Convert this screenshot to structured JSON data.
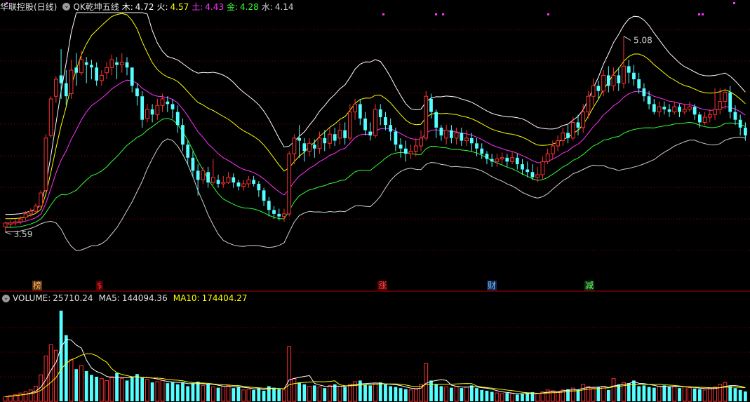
{
  "header": {
    "stock_name": "华联控股(日线)",
    "indicator_name": "QK乾坤五线",
    "values": [
      {
        "label": "木:",
        "value": "4.72",
        "color": "#ffffff"
      },
      {
        "label": "火:",
        "value": "4.57",
        "color": "#ffff00"
      },
      {
        "label": "土:",
        "value": "4.43",
        "color": "#ff33ff"
      },
      {
        "label": "金:",
        "value": "4.28",
        "color": "#33ff33"
      },
      {
        "label": "水:",
        "value": "4.14",
        "color": "#d0d0d0"
      }
    ]
  },
  "volume_header": {
    "name": "VOLUME:",
    "value": "25710.24",
    "ma5_label": "MA5:",
    "ma5_value": "144094.36",
    "ma10_label": "MA10:",
    "ma10_value": "174404.27"
  },
  "annotations": {
    "high_label": "5.08",
    "low_label": "3.59"
  },
  "signals": [
    {
      "text": "榜",
      "color": "#ffb366",
      "bg": "#5a3510"
    },
    {
      "text": "$",
      "color": "#ff3030",
      "bg": "#500000"
    },
    {
      "text": "涨",
      "color": "#ff5050",
      "bg": "#500000"
    },
    {
      "text": "财",
      "color": "#80c0ff",
      "bg": "#102850"
    },
    {
      "text": "减",
      "color": "#66ff66",
      "bg": "#103510"
    }
  ],
  "colors": {
    "up": "#ff3232",
    "down": "#54ffff",
    "grid": "#8b0000",
    "upper_band": "#ffffff",
    "mid_upper": "#ffff00",
    "middle": "#ff33ff",
    "mid_lower": "#33ff33",
    "lower_band": "#d0d0d0"
  },
  "chart_data": {
    "type": "candlestick",
    "price_range": [
      3.22,
      5.26
    ],
    "candles": [
      [
        3.62,
        3.65,
        3.58,
        3.66
      ],
      [
        3.64,
        3.65,
        3.62,
        3.67
      ],
      [
        3.65,
        3.66,
        3.63,
        3.68
      ],
      [
        3.66,
        3.68,
        3.64,
        3.7
      ],
      [
        3.69,
        3.72,
        3.67,
        3.74
      ],
      [
        3.72,
        3.74,
        3.7,
        3.76
      ],
      [
        3.74,
        3.78,
        3.72,
        3.8
      ],
      [
        3.78,
        3.88,
        3.77,
        3.9
      ],
      [
        3.9,
        4.3,
        3.89,
        4.33
      ],
      [
        4.32,
        4.6,
        4.3,
        4.62
      ],
      [
        4.62,
        4.75,
        4.57,
        4.77
      ],
      [
        4.78,
        4.72,
        4.6,
        4.98
      ],
      [
        4.72,
        4.62,
        4.55,
        4.82
      ],
      [
        4.64,
        4.82,
        4.6,
        4.9
      ],
      [
        4.84,
        4.8,
        4.7,
        4.95
      ],
      [
        4.8,
        4.9,
        4.78,
        4.97
      ],
      [
        4.88,
        4.86,
        4.72,
        4.92
      ],
      [
        4.86,
        4.84,
        4.75,
        4.9
      ],
      [
        4.84,
        4.74,
        4.7,
        4.88
      ],
      [
        4.74,
        4.78,
        4.7,
        4.82
      ],
      [
        4.8,
        4.84,
        4.75,
        4.88
      ],
      [
        4.84,
        4.9,
        4.78,
        4.94
      ],
      [
        4.88,
        4.86,
        4.75,
        4.92
      ],
      [
        4.86,
        4.88,
        4.8,
        4.95
      ],
      [
        4.88,
        4.84,
        4.78,
        4.92
      ],
      [
        4.84,
        4.7,
        4.65,
        4.76
      ],
      [
        4.68,
        4.62,
        4.55,
        4.72
      ],
      [
        4.62,
        4.44,
        4.38,
        4.66
      ],
      [
        4.45,
        4.52,
        4.42,
        4.56
      ],
      [
        4.52,
        4.48,
        4.42,
        4.56
      ],
      [
        4.48,
        4.55,
        4.44,
        4.6
      ],
      [
        4.55,
        4.6,
        4.5,
        4.64
      ],
      [
        4.58,
        4.56,
        4.5,
        4.62
      ],
      [
        4.56,
        4.52,
        4.45,
        4.6
      ],
      [
        4.5,
        4.4,
        4.34,
        4.55
      ],
      [
        4.4,
        4.25,
        4.2,
        4.45
      ],
      [
        4.25,
        4.15,
        4.1,
        4.28
      ],
      [
        4.15,
        4.05,
        4.0,
        4.2
      ],
      [
        4.05,
        3.98,
        3.86,
        4.1
      ],
      [
        3.98,
        4.05,
        3.95,
        4.08
      ],
      [
        4.04,
        3.96,
        3.92,
        4.08
      ],
      [
        3.96,
        4.0,
        3.94,
        4.14
      ],
      [
        3.98,
        3.95,
        3.92,
        4.02
      ],
      [
        3.95,
        3.96,
        3.92,
        4.01
      ],
      [
        3.96,
        4.0,
        3.95,
        4.04
      ],
      [
        4.0,
        3.96,
        3.92,
        4.03
      ],
      [
        3.96,
        3.93,
        3.9,
        3.98
      ],
      [
        3.93,
        3.95,
        3.9,
        3.98
      ],
      [
        3.95,
        3.98,
        3.92,
        4.01
      ],
      [
        3.98,
        3.95,
        3.93,
        4.01
      ],
      [
        3.95,
        3.9,
        3.85,
        3.97
      ],
      [
        3.9,
        3.82,
        3.78,
        3.92
      ],
      [
        3.82,
        3.75,
        3.7,
        3.85
      ],
      [
        3.75,
        3.72,
        3.68,
        3.78
      ],
      [
        3.72,
        3.7,
        3.67,
        3.76
      ],
      [
        3.7,
        3.72,
        3.66,
        3.76
      ],
      [
        3.72,
        4.18,
        3.7,
        4.2
      ],
      [
        4.18,
        4.3,
        4.1,
        4.33
      ],
      [
        4.3,
        4.28,
        4.15,
        4.4
      ],
      [
        4.26,
        4.2,
        4.12,
        4.3
      ],
      [
        4.2,
        4.26,
        4.16,
        4.3
      ],
      [
        4.25,
        4.22,
        4.15,
        4.29
      ],
      [
        4.22,
        4.3,
        4.18,
        4.35
      ],
      [
        4.3,
        4.26,
        4.2,
        4.36
      ],
      [
        4.26,
        4.33,
        4.22,
        4.38
      ],
      [
        4.33,
        4.28,
        4.24,
        4.38
      ],
      [
        4.3,
        4.36,
        4.25,
        4.42
      ],
      [
        4.36,
        4.3,
        4.25,
        4.42
      ],
      [
        4.3,
        4.5,
        4.28,
        4.56
      ],
      [
        4.5,
        4.56,
        4.44,
        4.6
      ],
      [
        4.56,
        4.45,
        4.4,
        4.6
      ],
      [
        4.45,
        4.36,
        4.32,
        4.5
      ],
      [
        4.35,
        4.32,
        4.28,
        4.42
      ],
      [
        4.32,
        4.52,
        4.3,
        4.56
      ],
      [
        4.52,
        4.46,
        4.4,
        4.56
      ],
      [
        4.46,
        4.4,
        4.36,
        4.5
      ],
      [
        4.4,
        4.35,
        4.28,
        4.45
      ],
      [
        4.35,
        4.25,
        4.2,
        4.38
      ],
      [
        4.25,
        4.22,
        4.15,
        4.3
      ],
      [
        4.22,
        4.18,
        4.12,
        4.28
      ],
      [
        4.18,
        4.2,
        4.14,
        4.25
      ],
      [
        4.2,
        4.24,
        4.16,
        4.3
      ],
      [
        4.24,
        4.3,
        4.2,
        4.36
      ],
      [
        4.3,
        4.62,
        4.28,
        4.66
      ],
      [
        4.6,
        4.5,
        4.45,
        4.64
      ],
      [
        4.5,
        4.38,
        4.3,
        4.52
      ],
      [
        4.38,
        4.32,
        4.28,
        4.4
      ],
      [
        4.3,
        4.36,
        4.25,
        4.4
      ],
      [
        4.36,
        4.3,
        4.26,
        4.4
      ],
      [
        4.3,
        4.34,
        4.25,
        4.38
      ],
      [
        4.34,
        4.28,
        4.24,
        4.38
      ],
      [
        4.28,
        4.3,
        4.24,
        4.36
      ],
      [
        4.3,
        4.26,
        4.2,
        4.34
      ],
      [
        4.26,
        4.22,
        4.16,
        4.3
      ],
      [
        4.22,
        4.18,
        4.14,
        4.26
      ],
      [
        4.18,
        4.14,
        4.1,
        4.2
      ],
      [
        4.14,
        4.12,
        4.08,
        4.18
      ],
      [
        4.12,
        4.14,
        4.08,
        4.18
      ],
      [
        4.14,
        4.15,
        4.1,
        4.19
      ],
      [
        4.15,
        4.12,
        4.08,
        4.18
      ],
      [
        4.12,
        4.15,
        4.1,
        4.2
      ],
      [
        4.15,
        4.1,
        4.06,
        4.18
      ],
      [
        4.1,
        4.06,
        4.02,
        4.14
      ],
      [
        4.06,
        4.04,
        4.0,
        4.12
      ],
      [
        4.04,
        4.0,
        3.98,
        4.1
      ],
      [
        4.0,
        4.02,
        3.96,
        4.08
      ],
      [
        4.02,
        4.12,
        3.98,
        4.16
      ],
      [
        4.12,
        4.18,
        4.1,
        4.22
      ],
      [
        4.18,
        4.24,
        4.14,
        4.28
      ],
      [
        4.24,
        4.28,
        4.2,
        4.32
      ],
      [
        4.28,
        4.34,
        4.24,
        4.38
      ],
      [
        4.34,
        4.3,
        4.26,
        4.4
      ],
      [
        4.3,
        4.42,
        4.28,
        4.46
      ],
      [
        4.42,
        4.38,
        4.32,
        4.48
      ],
      [
        4.38,
        4.5,
        4.34,
        4.56
      ],
      [
        4.5,
        4.62,
        4.45,
        4.66
      ],
      [
        4.62,
        4.7,
        4.55,
        4.76
      ],
      [
        4.7,
        4.66,
        4.6,
        4.74
      ],
      [
        4.66,
        4.78,
        4.62,
        4.82
      ],
      [
        4.78,
        4.7,
        4.65,
        4.85
      ],
      [
        4.7,
        4.78,
        4.66,
        4.84
      ],
      [
        4.78,
        4.72,
        4.66,
        4.84
      ],
      [
        4.72,
        4.85,
        4.68,
        5.08
      ],
      [
        4.85,
        4.8,
        4.72,
        4.9
      ],
      [
        4.8,
        4.75,
        4.7,
        4.86
      ],
      [
        4.75,
        4.68,
        4.64,
        4.8
      ],
      [
        4.68,
        4.62,
        4.58,
        4.72
      ],
      [
        4.62,
        4.56,
        4.52,
        4.66
      ],
      [
        4.56,
        4.5,
        4.48,
        4.6
      ],
      [
        4.5,
        4.54,
        4.46,
        4.58
      ],
      [
        4.54,
        4.52,
        4.48,
        4.58
      ],
      [
        4.52,
        4.5,
        4.46,
        4.56
      ],
      [
        4.5,
        4.54,
        4.48,
        4.58
      ],
      [
        4.54,
        4.5,
        4.46,
        4.56
      ],
      [
        4.5,
        4.52,
        4.48,
        4.56
      ],
      [
        4.52,
        4.54,
        4.5,
        4.58
      ],
      [
        4.54,
        4.48,
        4.44,
        4.56
      ],
      [
        4.48,
        4.42,
        4.38,
        4.5
      ],
      [
        4.42,
        4.46,
        4.4,
        4.5
      ],
      [
        4.46,
        4.48,
        4.42,
        4.52
      ],
      [
        4.48,
        4.52,
        4.44,
        4.68
      ],
      [
        4.52,
        4.58,
        4.48,
        4.68
      ],
      [
        4.58,
        4.65,
        4.52,
        4.68
      ],
      [
        4.65,
        4.5,
        4.45,
        4.7
      ],
      [
        4.5,
        4.44,
        4.4,
        4.55
      ],
      [
        4.44,
        4.38,
        4.32,
        4.48
      ],
      [
        4.38,
        4.32,
        4.28,
        4.42
      ]
    ],
    "volume_range": [
      0,
      260000
    ],
    "volumes": [
      12000,
      15000,
      18000,
      22000,
      25000,
      30000,
      40000,
      70000,
      120000,
      150000,
      135000,
      240000,
      175000,
      110000,
      85000,
      95000,
      80000,
      70000,
      65000,
      60000,
      55000,
      65000,
      75000,
      60000,
      55000,
      65000,
      72000,
      62000,
      58000,
      50000,
      52000,
      55000,
      48000,
      50000,
      45000,
      50000,
      40000,
      48000,
      52000,
      42000,
      45000,
      38000,
      36000,
      40000,
      42000,
      35000,
      38000,
      30000,
      32000,
      30000,
      35000,
      28000,
      40000,
      36000,
      32000,
      30000,
      145000,
      60000,
      50000,
      45000,
      40000,
      42000,
      38000,
      35000,
      42000,
      45000,
      40000,
      38000,
      45000,
      52000,
      55000,
      45000,
      42000,
      48000,
      50000,
      45000,
      40000,
      38000,
      35000,
      32000,
      30000,
      32000,
      45000,
      100000,
      55000,
      45000,
      40000,
      38000,
      36000,
      40000,
      35000,
      38000,
      42000,
      35000,
      30000,
      28000,
      25000,
      22000,
      20000,
      22000,
      20000,
      18000,
      20000,
      22000,
      24000,
      20000,
      25000,
      30000,
      28000,
      26000,
      30000,
      32000,
      35000,
      30000,
      45000,
      40000,
      35000,
      38000,
      40000,
      30000,
      60000,
      45000,
      50000,
      48000,
      55000,
      40000,
      42000,
      38000,
      36000,
      40000,
      42000,
      38000,
      40000,
      35000,
      38000,
      36000,
      34000,
      32000,
      30000,
      35000,
      38000,
      45000,
      50000,
      40000,
      35000,
      30000,
      26000
    ]
  }
}
